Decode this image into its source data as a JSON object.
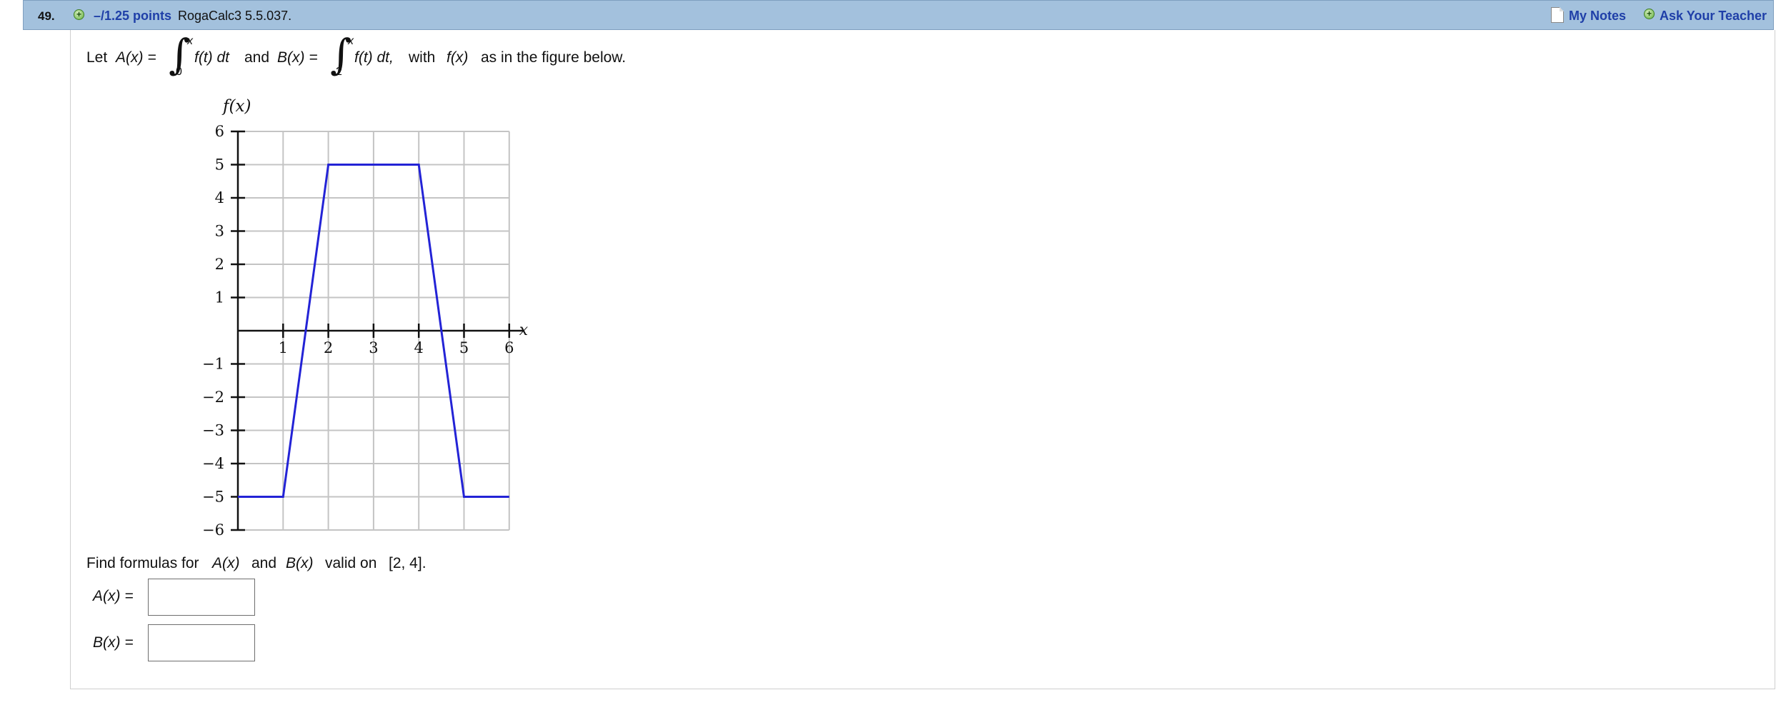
{
  "header": {
    "question_number": "49.",
    "points": "–/1.25 points",
    "source": "RogaCalc3 5.5.037.",
    "my_notes_label": "My Notes",
    "ask_teacher_label": "Ask Your Teacher"
  },
  "prompt": {
    "let": "Let",
    "A_def": "A(x) =",
    "and": "and",
    "B_def": "B(x) =",
    "integrand": "f(t) dt",
    "integrand_B": "f(t) dt,",
    "upper_limit": "x",
    "lower_limit_A": "0",
    "lower_limit_B": "2",
    "with": "with",
    "fx": "f(x)",
    "tail": "as in the figure below."
  },
  "find": {
    "text1": "Find formulas for",
    "A": "A(x)",
    "and": "and",
    "B": "B(x)",
    "valid_on": "valid on",
    "interval": "[2, 4]."
  },
  "answers": {
    "A_label": "A(x) =",
    "A_value": "",
    "B_label": "B(x) =",
    "B_value": ""
  },
  "chart_data": {
    "type": "line",
    "ylabel": "f(x)",
    "xlabel": "x",
    "xlim": [
      0,
      6
    ],
    "ylim": [
      -6,
      6
    ],
    "x_ticks": [
      "1",
      "2",
      "3",
      "4",
      "5",
      "6"
    ],
    "y_ticks": [
      "6",
      "5",
      "4",
      "3",
      "2",
      "1",
      "−1",
      "−2",
      "−3",
      "−4",
      "−5",
      "−6"
    ],
    "grid": true,
    "series": [
      {
        "x": [
          0,
          1,
          2,
          4,
          5,
          6
        ],
        "y": [
          -5,
          -5,
          5,
          5,
          -5,
          -5
        ],
        "color": "#2323d6"
      }
    ]
  }
}
